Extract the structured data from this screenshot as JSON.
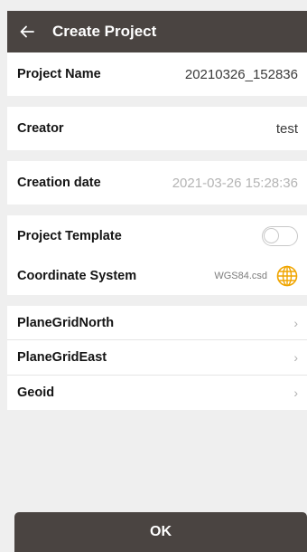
{
  "header": {
    "title": "Create Project",
    "back_icon": "arrow-left-icon"
  },
  "fields": {
    "project_name": {
      "label": "Project Name",
      "value": "20210326_152836"
    },
    "creator": {
      "label": "Creator",
      "value": "test"
    },
    "creation_date": {
      "label": "Creation date",
      "value": "2021-03-26 15:28:36"
    },
    "project_template": {
      "label": "Project Template",
      "enabled": false
    },
    "coordinate_system": {
      "label": "Coordinate System",
      "value": "WGS84.csd",
      "icon": "globe-icon"
    }
  },
  "nav_items": [
    {
      "label": "PlaneGridNorth"
    },
    {
      "label": "PlaneGridEast"
    },
    {
      "label": "Geoid"
    }
  ],
  "ok_button": {
    "label": "OK"
  },
  "colors": {
    "header_bg": "#4a4441",
    "accent": "#f0a500",
    "page_bg": "#efefef"
  }
}
